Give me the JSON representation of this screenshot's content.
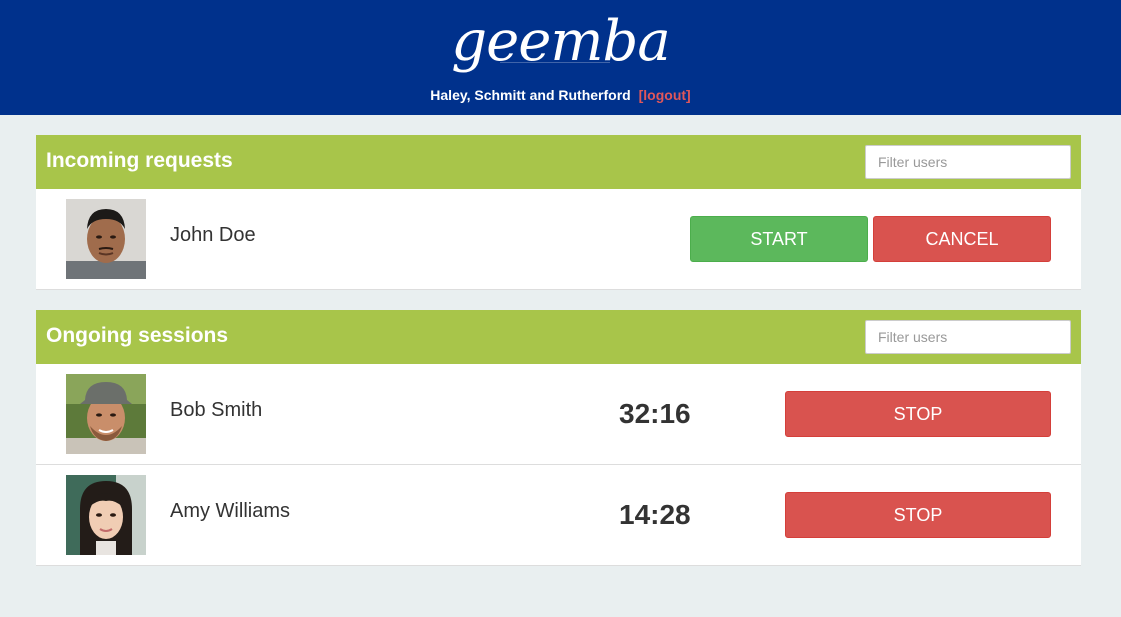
{
  "header": {
    "logo_text": "geemba",
    "account_name": "Haley, Schmitt and Rutherford",
    "logout_label": "[logout]"
  },
  "incoming": {
    "title": "Incoming requests",
    "filter_placeholder": "Filter users",
    "rows": [
      {
        "name": "John Doe",
        "start_label": "START",
        "cancel_label": "CANCEL"
      }
    ]
  },
  "ongoing": {
    "title": "Ongoing sessions",
    "filter_placeholder": "Filter users",
    "rows": [
      {
        "name": "Bob Smith",
        "timer": "32:16",
        "stop_label": "STOP"
      },
      {
        "name": "Amy Williams",
        "timer": "14:28",
        "stop_label": "STOP"
      }
    ]
  },
  "colors": {
    "header_bg": "#00318c",
    "panel_header_bg": "#a8c54a",
    "page_bg": "#e9eff0",
    "start_green": "#5cb85c",
    "danger_red": "#d9534f",
    "logout_red": "#e0575a"
  }
}
